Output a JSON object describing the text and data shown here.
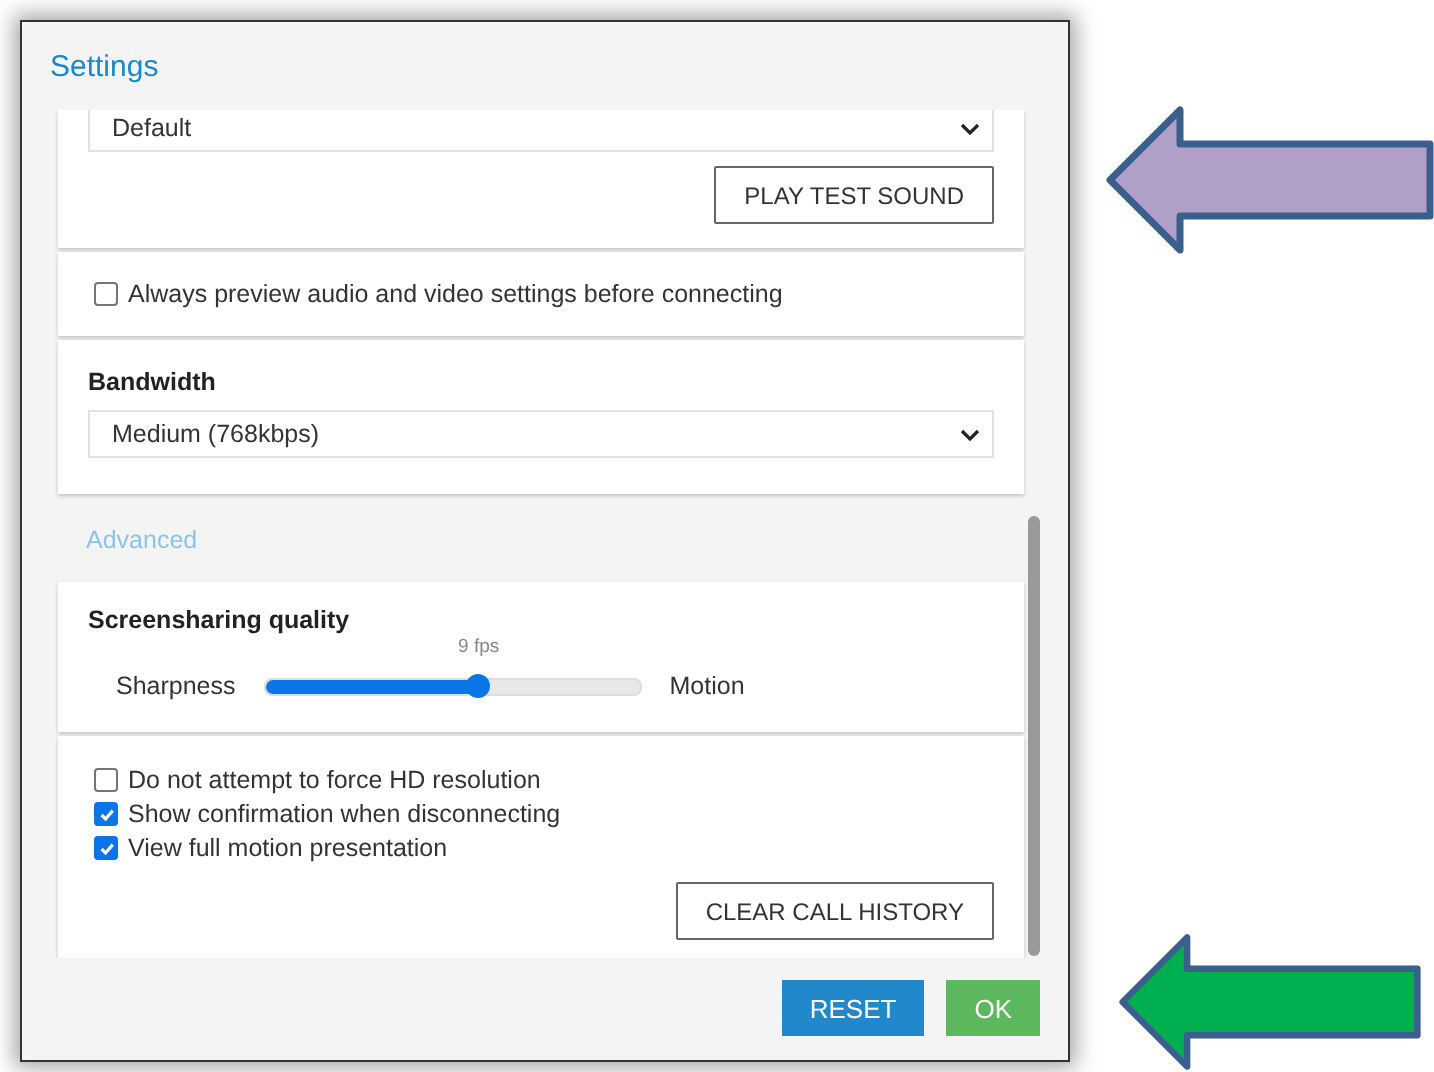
{
  "window": {
    "title": "Settings"
  },
  "audio_output": {
    "value": "Default"
  },
  "test_button": "PLAY TEST SOUND",
  "preview_option": {
    "label": "Always preview audio and video settings before connecting",
    "checked": false
  },
  "bandwidth": {
    "label": "Bandwidth",
    "value": "Medium (768kbps)"
  },
  "advanced_link": "Advanced",
  "screensharing": {
    "title": "Screensharing quality",
    "reading": "9 fps",
    "left_label": "Sharpness",
    "right_label": "Motion",
    "level": 0.57
  },
  "options": [
    {
      "label": "Do not attempt to force HD resolution",
      "checked": false
    },
    {
      "label": "Show confirmation when disconnecting",
      "checked": true
    },
    {
      "label": "View full motion presentation",
      "checked": true
    }
  ],
  "clear_button": "CLEAR CALL HISTORY",
  "buttons": [
    {
      "label": "RESET",
      "kind": "reset"
    },
    {
      "label": "OK",
      "kind": "ok"
    }
  ],
  "arrows": [
    {
      "color": "#b0a0c8"
    },
    {
      "color": "#00b050"
    }
  ]
}
